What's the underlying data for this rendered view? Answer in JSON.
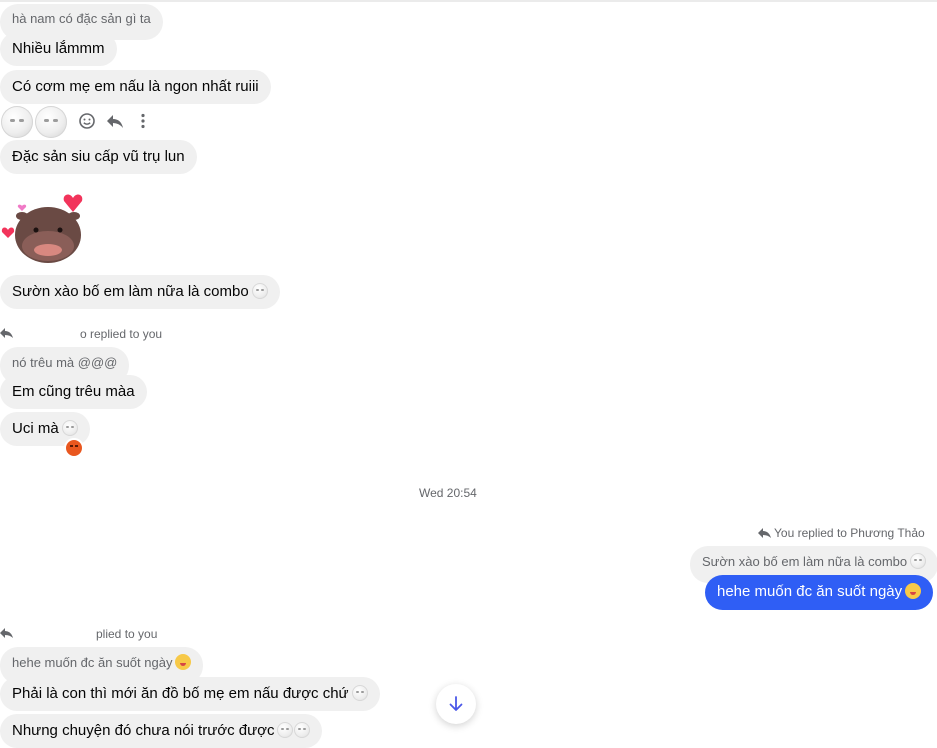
{
  "messages": {
    "m1": "hà nam có đặc sản gì ta",
    "m2": "Nhiều lắmmm",
    "m3": "Có cơm mẹ em nấu là ngon nhất ruiii",
    "m4": "Đặc sản siu cấp vũ trụ lun",
    "m5": "Sườn xào bố em làm nữa là combo",
    "reply1_label": "o replied to you",
    "reply1_quote": "nó trêu mà @@@",
    "m6": "Em cũng trêu màa",
    "m7": "Uci mà",
    "timestamp": "Wed 20:54",
    "reply2_label": "You replied to Phương Thảo",
    "reply2_quote": "Sườn xào bố em làm nữa là combo",
    "m8": "hehe muốn đc ăn suốt ngày",
    "reply3_label": "plied to you",
    "reply3_quote": "hehe muốn đc ăn suốt ngày",
    "m9": "Phải là con thì mới ăn đồ bố mẹ em nấu được chứ",
    "m10": "Nhưng chuyện đó chưa nói trước được"
  },
  "icons": {
    "react": "smiley-icon",
    "reply": "reply-icon",
    "more": "more-vertical-icon",
    "scroll": "arrow-down-icon",
    "sticker": "hippo-hearts-sticker"
  },
  "colors": {
    "my_bubble": "#2f5ef5",
    "their_bubble": "#f0f0f0",
    "scroll_arrow": "#4a57e8"
  }
}
